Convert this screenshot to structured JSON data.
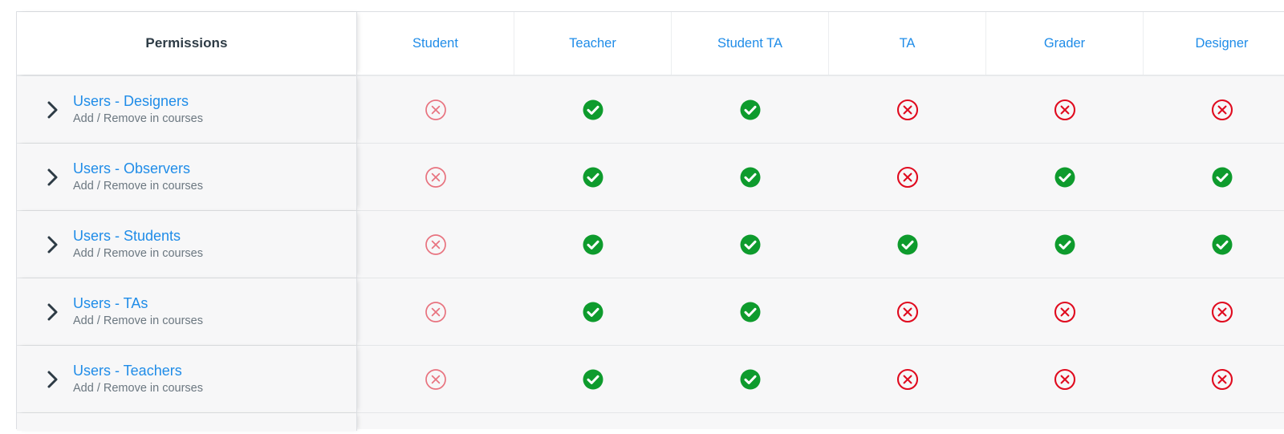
{
  "table": {
    "permissions_header": "Permissions",
    "role_columns": [
      {
        "label": "Student"
      },
      {
        "label": "Teacher"
      },
      {
        "label": "Student TA"
      },
      {
        "label": "TA"
      },
      {
        "label": "Grader"
      },
      {
        "label": "Designer"
      }
    ],
    "expand_icon": "chevron-right-icon",
    "states": {
      "enabled": {
        "icon": "check-circle-icon",
        "color": "#0e9b2d"
      },
      "disabled": {
        "icon": "x-circle-icon",
        "color": "#e00b1f"
      },
      "locked": {
        "icon": "x-circle-icon",
        "color": "#e8737f"
      }
    },
    "rows": [
      {
        "title": "Users - Designers",
        "subtitle": "Add / Remove in courses",
        "cells": [
          "locked",
          "enabled",
          "enabled",
          "disabled",
          "disabled",
          "disabled"
        ]
      },
      {
        "title": "Users - Observers",
        "subtitle": "Add / Remove in courses",
        "cells": [
          "locked",
          "enabled",
          "enabled",
          "disabled",
          "enabled",
          "enabled"
        ]
      },
      {
        "title": "Users - Students",
        "subtitle": "Add / Remove in courses",
        "cells": [
          "locked",
          "enabled",
          "enabled",
          "enabled",
          "enabled",
          "enabled"
        ]
      },
      {
        "title": "Users - TAs",
        "subtitle": "Add / Remove in courses",
        "cells": [
          "locked",
          "enabled",
          "enabled",
          "disabled",
          "disabled",
          "disabled"
        ]
      },
      {
        "title": "Users - Teachers",
        "subtitle": "Add / Remove in courses",
        "cells": [
          "locked",
          "enabled",
          "enabled",
          "disabled",
          "disabled",
          "disabled"
        ]
      }
    ]
  }
}
